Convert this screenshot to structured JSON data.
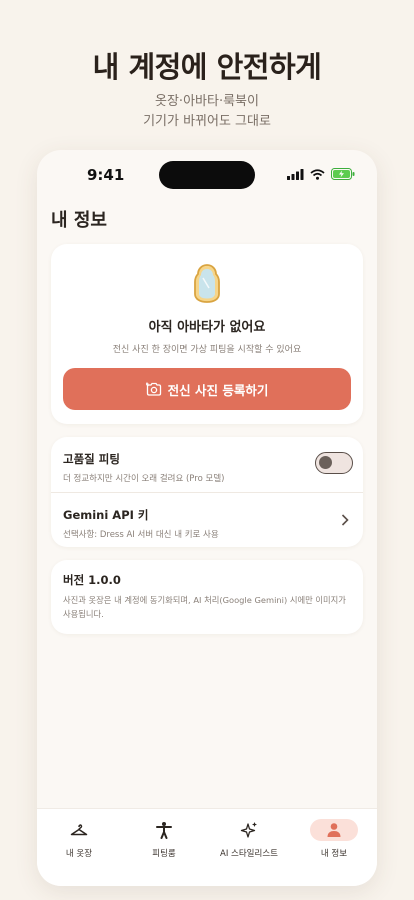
{
  "promo": {
    "title": "내 계정에 안전하게",
    "subtitle_line1": "옷장·아바타·룩북이",
    "subtitle_line2": "기기가 바뀌어도 그대로"
  },
  "status_bar": {
    "time": "9:41"
  },
  "page": {
    "title": "내 정보"
  },
  "avatar_card": {
    "icon": "mirror-icon",
    "title": "아직 아바타가 없어요",
    "description": "전신 사진 한 장이면 가상 피팅을 시작할 수 있어요",
    "button_label": "전신 사진 등록하기",
    "button_icon": "camera-add-icon"
  },
  "settings": {
    "hq_fitting": {
      "title": "고품질 피팅",
      "description": "더 정교하지만 시간이 오래 걸려요 (Pro 모델)",
      "enabled": false
    },
    "gemini_key": {
      "title": "Gemini API 키",
      "description": "선택사항: Dress AI 서버 대신 내 키로 사용"
    }
  },
  "version": {
    "title": "버전 1.0.0",
    "description": "사진과 옷장은 내 계정에 동기화되며, AI 처리(Google Gemini) 시에만 이미지가 사용됩니다."
  },
  "tabs": [
    {
      "label": "내 옷장",
      "icon": "hanger-icon"
    },
    {
      "label": "피팅룸",
      "icon": "person-pose-icon"
    },
    {
      "label": "AI 스타일리스트",
      "icon": "sparkle-icon"
    },
    {
      "label": "내 정보",
      "icon": "user-icon",
      "active": true
    }
  ],
  "colors": {
    "accent": "#e0705a",
    "background": "#f8f3ec",
    "active_tab_bg": "#fbe0d9"
  }
}
